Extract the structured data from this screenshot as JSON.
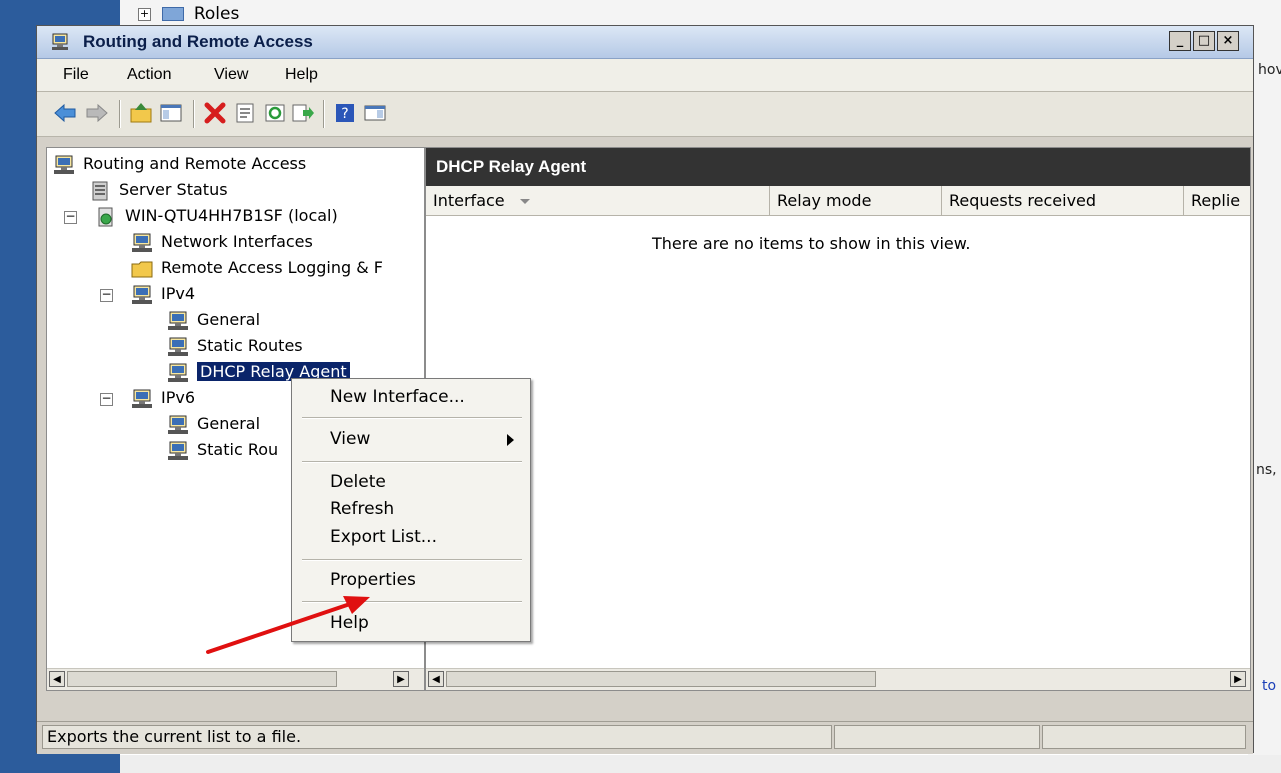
{
  "background": {
    "roles_label": "Roles",
    "right_snips": [
      "hov",
      "ns,",
      "to"
    ]
  },
  "window": {
    "title": "Routing and Remote Access",
    "buttons": {
      "minimize": "_",
      "maximize": "□",
      "close": "×"
    }
  },
  "menu": [
    "File",
    "Action",
    "View",
    "Help"
  ],
  "toolbar": {
    "icons": [
      "back-icon",
      "forward-icon",
      "up-folder-icon",
      "show-hide-tree-icon",
      "delete-icon",
      "properties-icon",
      "refresh-icon",
      "export-list-icon",
      "help-icon",
      "action-pane-icon"
    ]
  },
  "tree": {
    "root": "Routing and Remote Access",
    "server_status": "Server Status",
    "server": "WIN-QTU4HH7B1SF (local)",
    "network_interfaces": "Network Interfaces",
    "remote_access_logging": "Remote Access Logging & F",
    "ipv4": "IPv4",
    "ipv4_general": "General",
    "ipv4_static_routes": "Static Routes",
    "ipv4_dhcp_relay": "DHCP Relay Agent",
    "ipv6": "IPv6",
    "ipv6_general": "General",
    "ipv6_static_routes": "Static Rou"
  },
  "details": {
    "header": "DHCP Relay Agent",
    "columns": [
      "Interface",
      "Relay mode",
      "Requests received",
      "Replie"
    ],
    "empty_message": "There are no items to show in this view."
  },
  "context_menu": {
    "new_interface": "New Interface...",
    "view": "View",
    "delete": "Delete",
    "refresh": "Refresh",
    "export_list": "Export List...",
    "properties": "Properties",
    "help": "Help"
  },
  "status_bar": {
    "text": "Exports the current list to a file."
  },
  "colors": {
    "selection": "#0a246a",
    "header_dark": "#333333",
    "annotation_arrow": "#e01010"
  }
}
